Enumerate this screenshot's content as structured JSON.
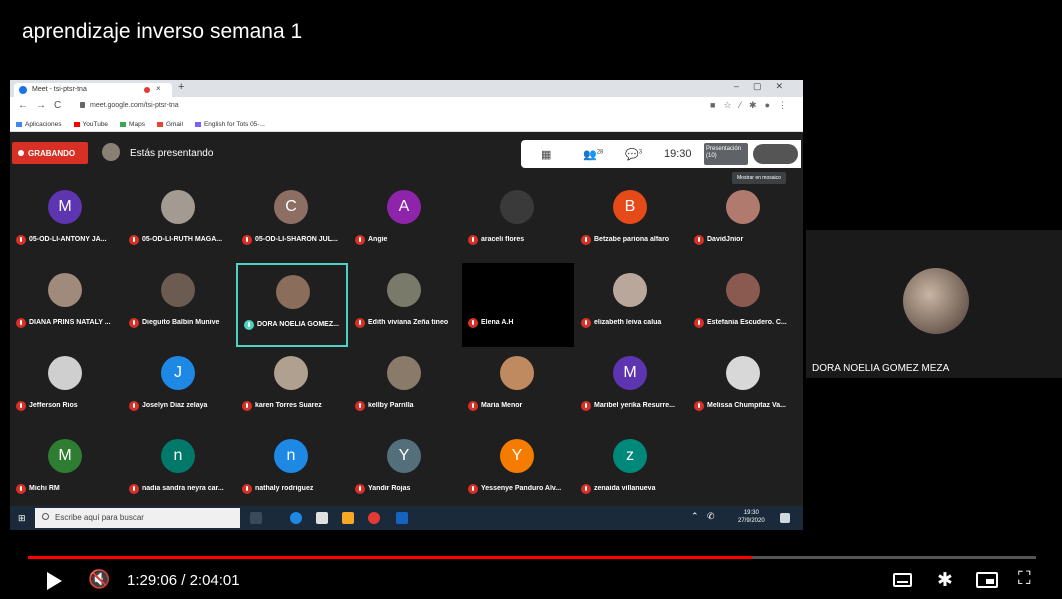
{
  "video": {
    "title": "aprendizaje inverso semana 1",
    "time_current": "1:29:06",
    "time_separator": " / ",
    "time_total": "2:04:01",
    "progress_fraction": 0.718
  },
  "browser": {
    "tab_title": "Meet - tsi-ptsr-tna",
    "tab_close": "×",
    "new_tab": "+",
    "window_controls": "–▢✕",
    "url": "meet.google.com/tsi-ptsr-tna",
    "nav": "←→C",
    "addr_icons": "■☆⁄✱●⋮",
    "bookmarks": [
      {
        "label": "Aplicaciones",
        "color": "#4285f4"
      },
      {
        "label": "YouTube",
        "color": "#ff0000"
      },
      {
        "label": "Maps",
        "color": "#34a853"
      },
      {
        "label": "Gmail",
        "color": "#ea4335"
      },
      {
        "label": "English for Tots 05-...",
        "color": "#7b61ff"
      }
    ]
  },
  "meet": {
    "recording_label": "GRABANDO",
    "presenting_label": "Estás presentando",
    "toolbar": {
      "grid_icon": "▦",
      "people_icon": "👥",
      "people_count": "28",
      "chat_icon": "💬",
      "chat_count": "3",
      "time": "19:30",
      "presentation_label": "Presentación",
      "presentation_count": "(10)"
    },
    "tooltip": "Mostrar en mosaico",
    "participants": [
      {
        "name": "05-OD-LI-ANTONY JA...",
        "initial": "M",
        "color": "#5e35b1"
      },
      {
        "name": "05-OD-LI-RUTH MAGA...",
        "initial": "",
        "color": "#a39b91"
      },
      {
        "name": "05-OD-LI-SHARON JUL...",
        "initial": "C",
        "color": "#8d6e63"
      },
      {
        "name": "Angie",
        "initial": "A",
        "color": "#8e24aa"
      },
      {
        "name": "araceli flores",
        "initial": "",
        "color": "#3a3a3a"
      },
      {
        "name": "Betzabe pariona alfaro",
        "initial": "B",
        "color": "#e64a19"
      },
      {
        "name": "DavidJnior",
        "initial": "",
        "color": "#b07a6e"
      },
      {
        "name": "DIANA PRINS NATALY ...",
        "initial": "",
        "color": "#a08a7b"
      },
      {
        "name": "Dieguito Balbin Munive",
        "initial": "",
        "color": "#6b5b50"
      },
      {
        "name": "DORA NOELIA GOMEZ...",
        "initial": "",
        "color": "#8a6d5a"
      },
      {
        "name": "Edith viviana Zeña tineo",
        "initial": "",
        "color": "#7a7a6a"
      },
      {
        "name": "Elena A.H",
        "initial": "",
        "color": "#000000"
      },
      {
        "name": "elizabeth leiva calua",
        "initial": "",
        "color": "#b8a79a"
      },
      {
        "name": "Estefania Escudero. C...",
        "initial": "",
        "color": "#8a5a50"
      },
      {
        "name": "Jefferson Rios",
        "initial": "",
        "color": "#cfcfcf"
      },
      {
        "name": "Joselyn Diaz zelaya",
        "initial": "J",
        "color": "#1e88e5"
      },
      {
        "name": "karen Torres Suarez",
        "initial": "",
        "color": "#b0a090"
      },
      {
        "name": "kellby Parrilla",
        "initial": "",
        "color": "#8a7a6a"
      },
      {
        "name": "Maria Menor",
        "initial": "",
        "color": "#c08a60"
      },
      {
        "name": "Maribel yerika Resurre...",
        "initial": "M",
        "color": "#5e35b1"
      },
      {
        "name": "Melissa Chumpitaz Va...",
        "initial": "",
        "color": "#d8d8d8"
      },
      {
        "name": "Michi RM",
        "initial": "M",
        "color": "#2e7d32"
      },
      {
        "name": "nadia sandra neyra car...",
        "initial": "n",
        "color": "#00796b"
      },
      {
        "name": "nathaly rodriguez",
        "initial": "n",
        "color": "#1e88e5"
      },
      {
        "name": "Yandir Rojas",
        "initial": "Y",
        "color": "#546e7a"
      },
      {
        "name": "Yessenye Panduro Alv...",
        "initial": "Y",
        "color": "#f57c00"
      },
      {
        "name": "zenaida villanueva",
        "initial": "z",
        "color": "#00897b"
      }
    ]
  },
  "taskbar": {
    "start_icon": "⊞",
    "search_placeholder": "Escribe aquí para buscar",
    "tray": "⌃ ✆",
    "clock_time": "19:30",
    "clock_date": "27/9/2020"
  },
  "camera": {
    "name": "DORA NOELIA GOMEZ MEZA"
  },
  "player_icons": {
    "mute": "🔇",
    "settings": "✱",
    "exit_fullscreen": "⛶"
  }
}
